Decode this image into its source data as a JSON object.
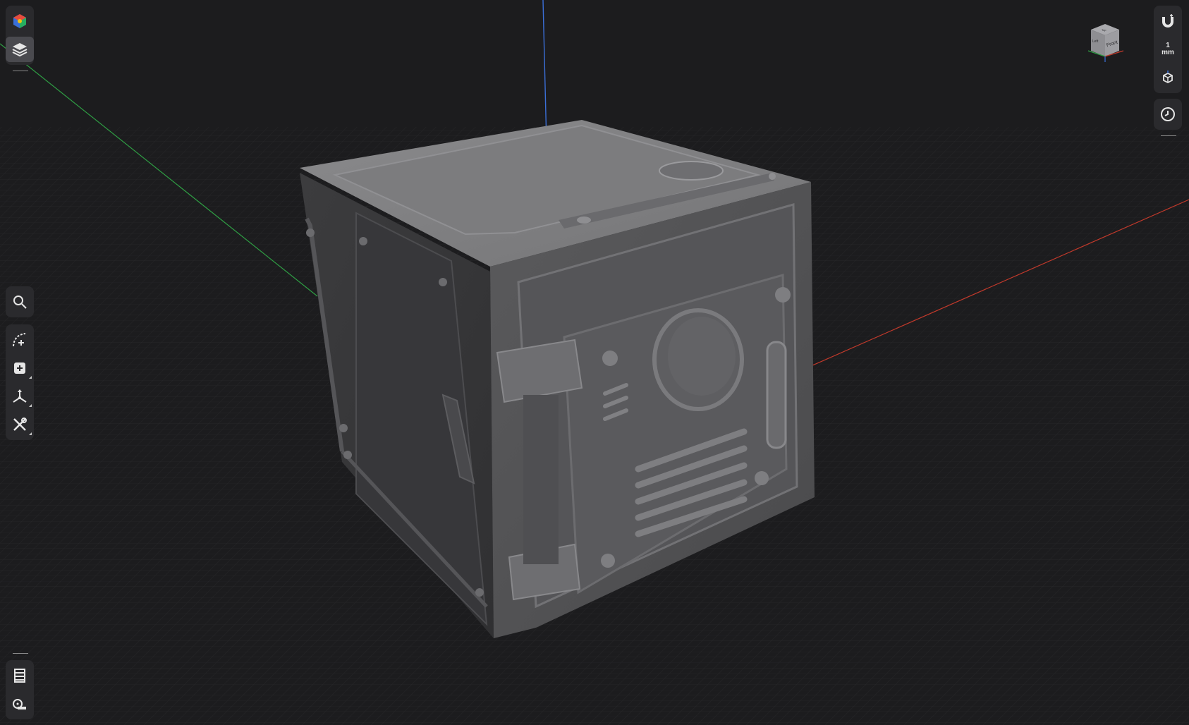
{
  "app": {
    "accent": "#5b8cff",
    "background": "#1c1c1e"
  },
  "left_toolbar": {
    "top_group": [
      {
        "name": "appearance-icon",
        "active": false
      },
      {
        "name": "layers-icon",
        "active": true
      }
    ],
    "middle_search": {
      "name": "search-icon"
    },
    "middle_tools": [
      {
        "name": "sketch-curve-icon"
      },
      {
        "name": "add-primitive-icon"
      },
      {
        "name": "transform-icon"
      },
      {
        "name": "tools-icon"
      }
    ],
    "bottom_tools": [
      {
        "name": "section-view-icon"
      },
      {
        "name": "measure-tape-icon"
      }
    ]
  },
  "right_toolbar": {
    "snap": {
      "name": "magnet-snap-icon"
    },
    "unit": {
      "value": "1",
      "unit": "mm"
    },
    "view_mode": {
      "name": "orientation-cube-icon"
    },
    "history": {
      "name": "history-clock-icon"
    }
  },
  "view_cube": {
    "front_label": "Front",
    "left_label": "Left",
    "top_label": "Top"
  },
  "axes": {
    "x_color": "#c0392b",
    "y_color": "#2f9e44",
    "z_color": "#3b6fd8"
  }
}
